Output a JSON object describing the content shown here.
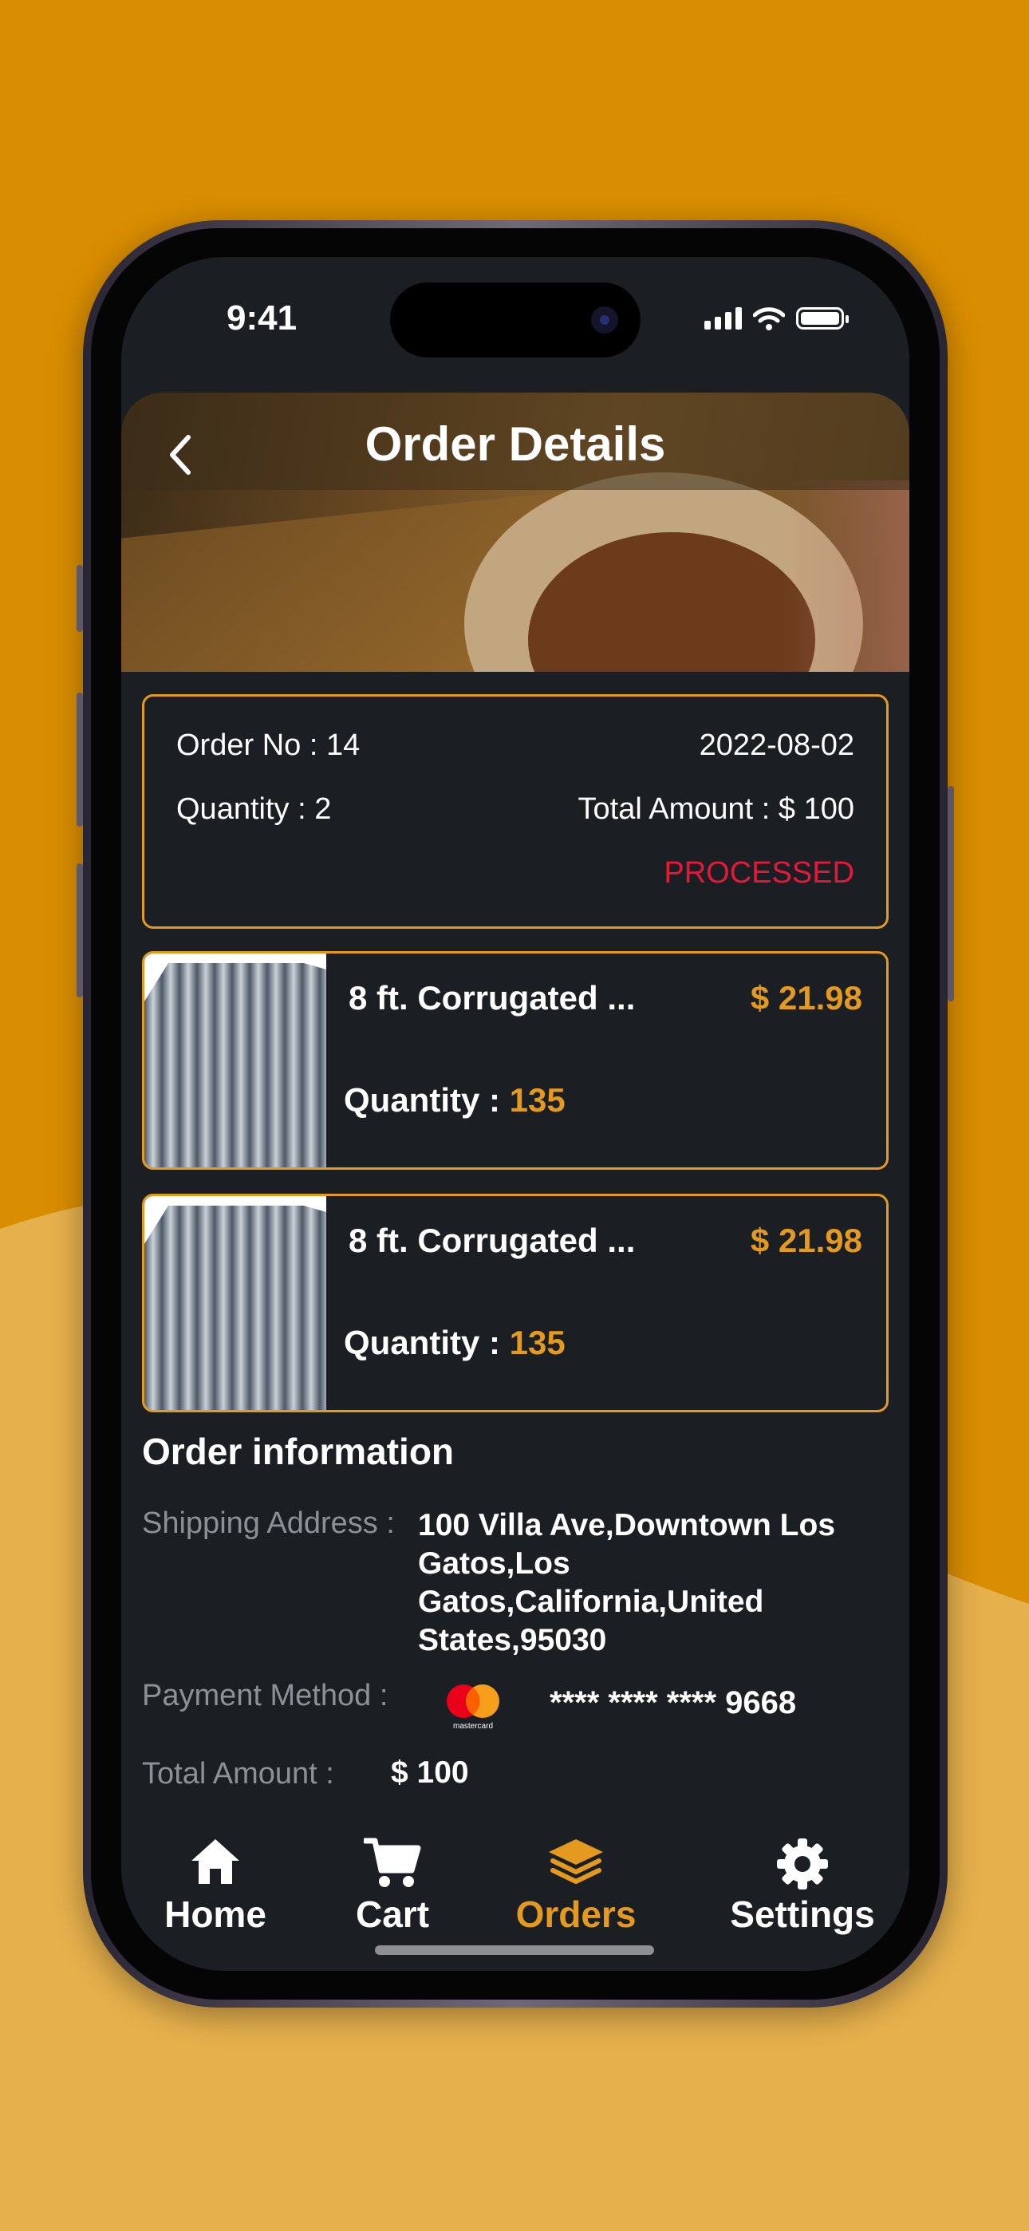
{
  "status_bar": {
    "time": "9:41"
  },
  "header": {
    "title": "Order Details"
  },
  "order": {
    "order_no": "Order No : 14",
    "date": "2022-08-02",
    "quantity": "Quantity : 2",
    "total_amount": "Total Amount : $ 100",
    "status": "PROCESSED"
  },
  "items": [
    {
      "name": "8 ft. Corrugated ...",
      "price": "$ 21.98",
      "quantity_label": "Quantity :",
      "quantity_value": "135"
    },
    {
      "name": "8 ft. Corrugated ...",
      "price": "$ 21.98",
      "quantity_label": "Quantity :",
      "quantity_value": "135"
    }
  ],
  "order_information": {
    "title": "Order information",
    "shipping_label": "Shipping Address :",
    "shipping_lines": [
      "100 Villa Ave,Downtown Los",
      "Gatos,Los",
      "Gatos,California,United",
      "States,95030"
    ],
    "payment_label": "Payment Method :",
    "payment_brand": "mastercard",
    "card_number": "**** **** **** 9668",
    "total_label": "Total Amount :",
    "total_value": "$ 100"
  },
  "tab_bar": {
    "items": [
      {
        "label": "Home",
        "icon": "home-icon"
      },
      {
        "label": "Cart",
        "icon": "cart-icon"
      },
      {
        "label": "Orders",
        "icon": "layers-icon",
        "active": true
      },
      {
        "label": "Settings",
        "icon": "gear-icon"
      }
    ]
  },
  "colors": {
    "accent": "#E39A1E",
    "background": "#D98D00",
    "wave": "#E6B04C",
    "screen": "#1B1F23",
    "status_processed": "#E5183A"
  }
}
